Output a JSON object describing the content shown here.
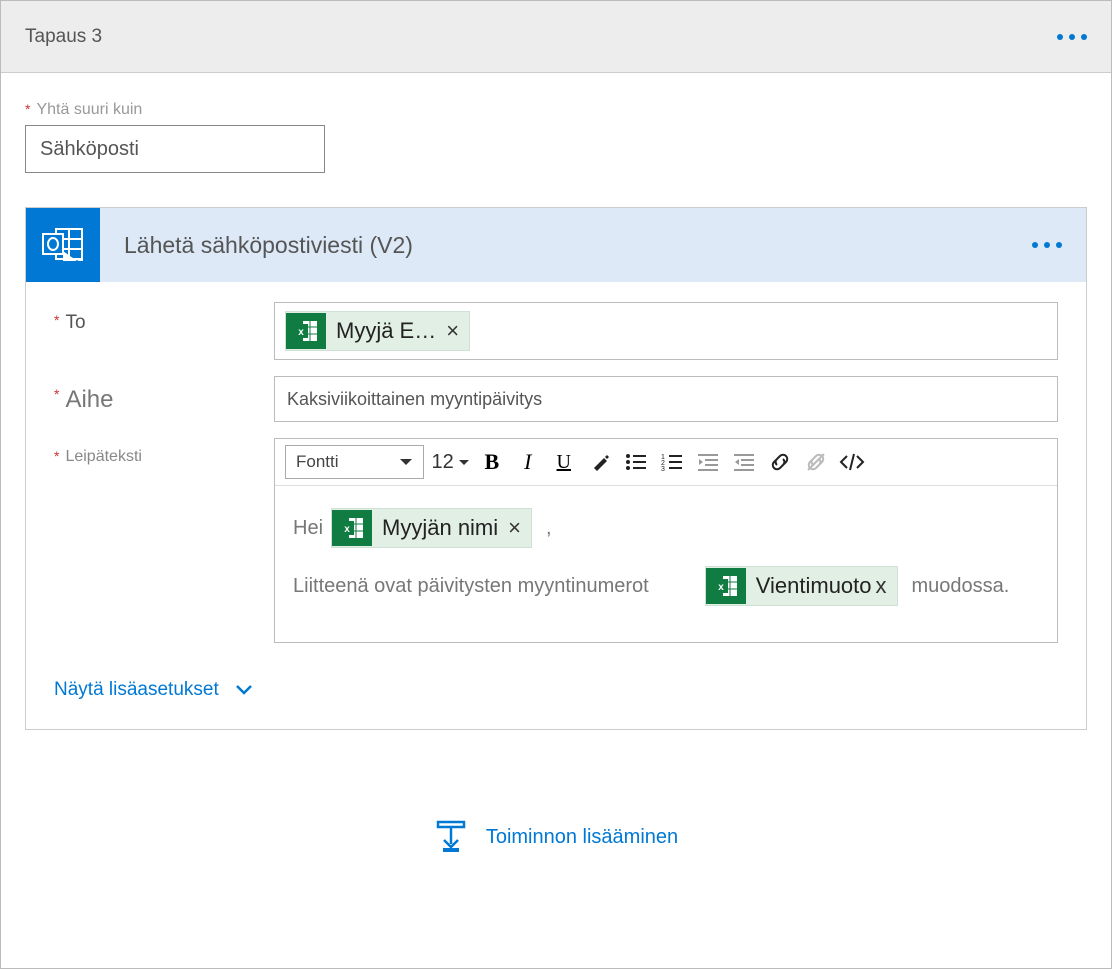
{
  "case": {
    "title": "Tapaus 3"
  },
  "equals": {
    "label": "Yhtä suuri kuin",
    "value": "Sähköposti"
  },
  "action": {
    "title": "Lähetä sähköpostiviesti (V2)"
  },
  "fields": {
    "to_label": "To",
    "to_token": "Myyjä E…",
    "subject_label": "Aihe",
    "subject_value": "Kaksiviikoittainen myyntipäivitys",
    "body_label": "Leipäteksti"
  },
  "rte": {
    "font_label": "Fontti",
    "font_size": "12"
  },
  "body": {
    "greeting": "Hei",
    "token_name": "Myyjän nimi",
    "comma": ",",
    "line2_pre": "Liitteenä ovat päivitysten myyntinumerot",
    "token_format": "Vientimuoto",
    "line2_post": "muodossa."
  },
  "advanced": {
    "label": "Näytä lisäasetukset"
  },
  "add_action": {
    "label": "Toiminnon lisääminen"
  }
}
